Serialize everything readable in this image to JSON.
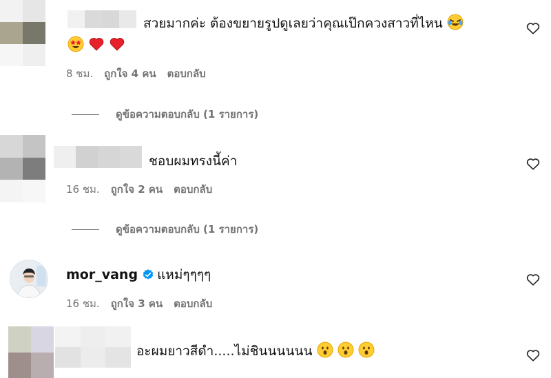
{
  "comments": [
    {
      "text": "สวยมากค่ะ ต้องขยายรูปดูเลยว่าคุณเป๊กควงสาวที่ไหน",
      "time": "8 ชม.",
      "likes": "ถูกใจ 4 คน",
      "reply": "ตอบกลับ",
      "view_replies": "ดูข้อความตอบกลับ (1 รายการ)"
    },
    {
      "text": "ชอบผมทรงนี้ค่า",
      "time": "16 ชม.",
      "likes": "ถูกใจ 2 คน",
      "reply": "ตอบกลับ",
      "view_replies": "ดูข้อความตอบกลับ (1 รายการ)"
    },
    {
      "username": "mor_vang",
      "text": "แหม่ๆๆๆๆ",
      "time": "16 ชม.",
      "likes": "ถูกใจ 3 คน",
      "reply": "ตอบกลับ"
    },
    {
      "text": "อะผมยาวสีดำ.....ไม่ชินนนนนน"
    }
  ],
  "icons": {
    "like": "heart-outline-icon",
    "verified": "verified-badge-icon"
  },
  "colors": {
    "meta": "#737373",
    "verified": "#0095f6"
  }
}
